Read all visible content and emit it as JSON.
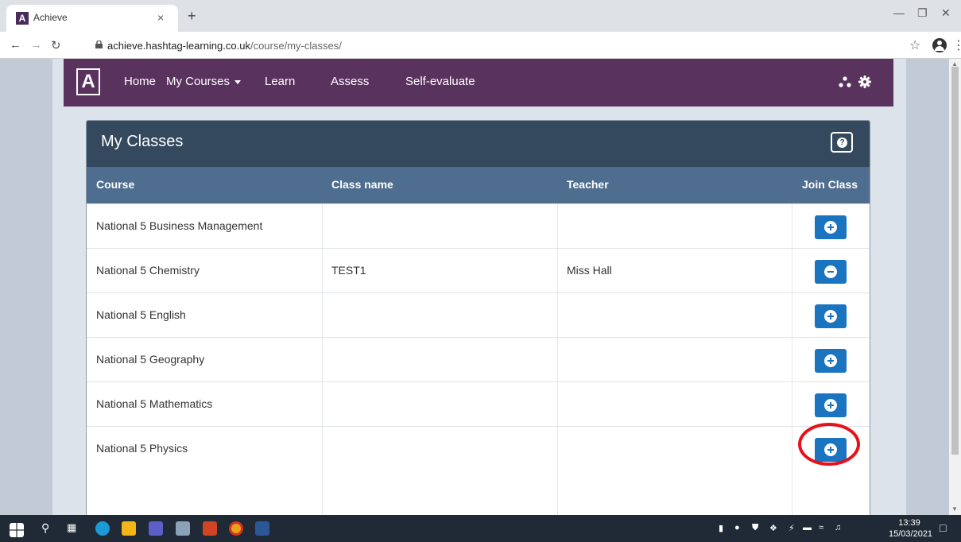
{
  "browser": {
    "tab_title": "Achieve",
    "tab_favicon_letter": "A",
    "tab_close": "×",
    "new_tab": "+",
    "url_domain": "achieve.hashtag-learning.co.uk",
    "url_path": "/course/my-classes/"
  },
  "app": {
    "logo_letter": "A",
    "nav": {
      "home": "Home",
      "my_courses": "My Courses",
      "learn": "Learn",
      "assess": "Assess",
      "self_evaluate": "Self-evaluate"
    }
  },
  "panel": {
    "title": "My Classes",
    "columns": [
      "Course",
      "Class name",
      "Teacher",
      "Join Class"
    ],
    "rows": [
      {
        "course": "National 5 Business Management",
        "class_name": "",
        "teacher": "",
        "action": "join"
      },
      {
        "course": "National 5 Chemistry",
        "class_name": "TEST1",
        "teacher": "Miss Hall",
        "action": "leave"
      },
      {
        "course": "National 5 English",
        "class_name": "",
        "teacher": "",
        "action": "join"
      },
      {
        "course": "National 5 Geography",
        "class_name": "",
        "teacher": "",
        "action": "join"
      },
      {
        "course": "National 5 Mathematics",
        "class_name": "",
        "teacher": "",
        "action": "join"
      },
      {
        "course": "National 5 Physics",
        "class_name": "",
        "teacher": "",
        "action": "join"
      }
    ]
  },
  "icons": {
    "help": "question-circle-icon",
    "join": "plus-circle-icon",
    "leave": "minus-circle-icon",
    "tree": "sitemap-icon",
    "settings": "gear-icon"
  },
  "colors": {
    "nav_bg": "#5a325e",
    "panel_header": "#34495e",
    "table_header": "#4f6d8f",
    "button": "#1b74c0",
    "highlight": "#e8101b"
  },
  "taskbar": {
    "time": "13:39",
    "date": "15/03/2021"
  }
}
